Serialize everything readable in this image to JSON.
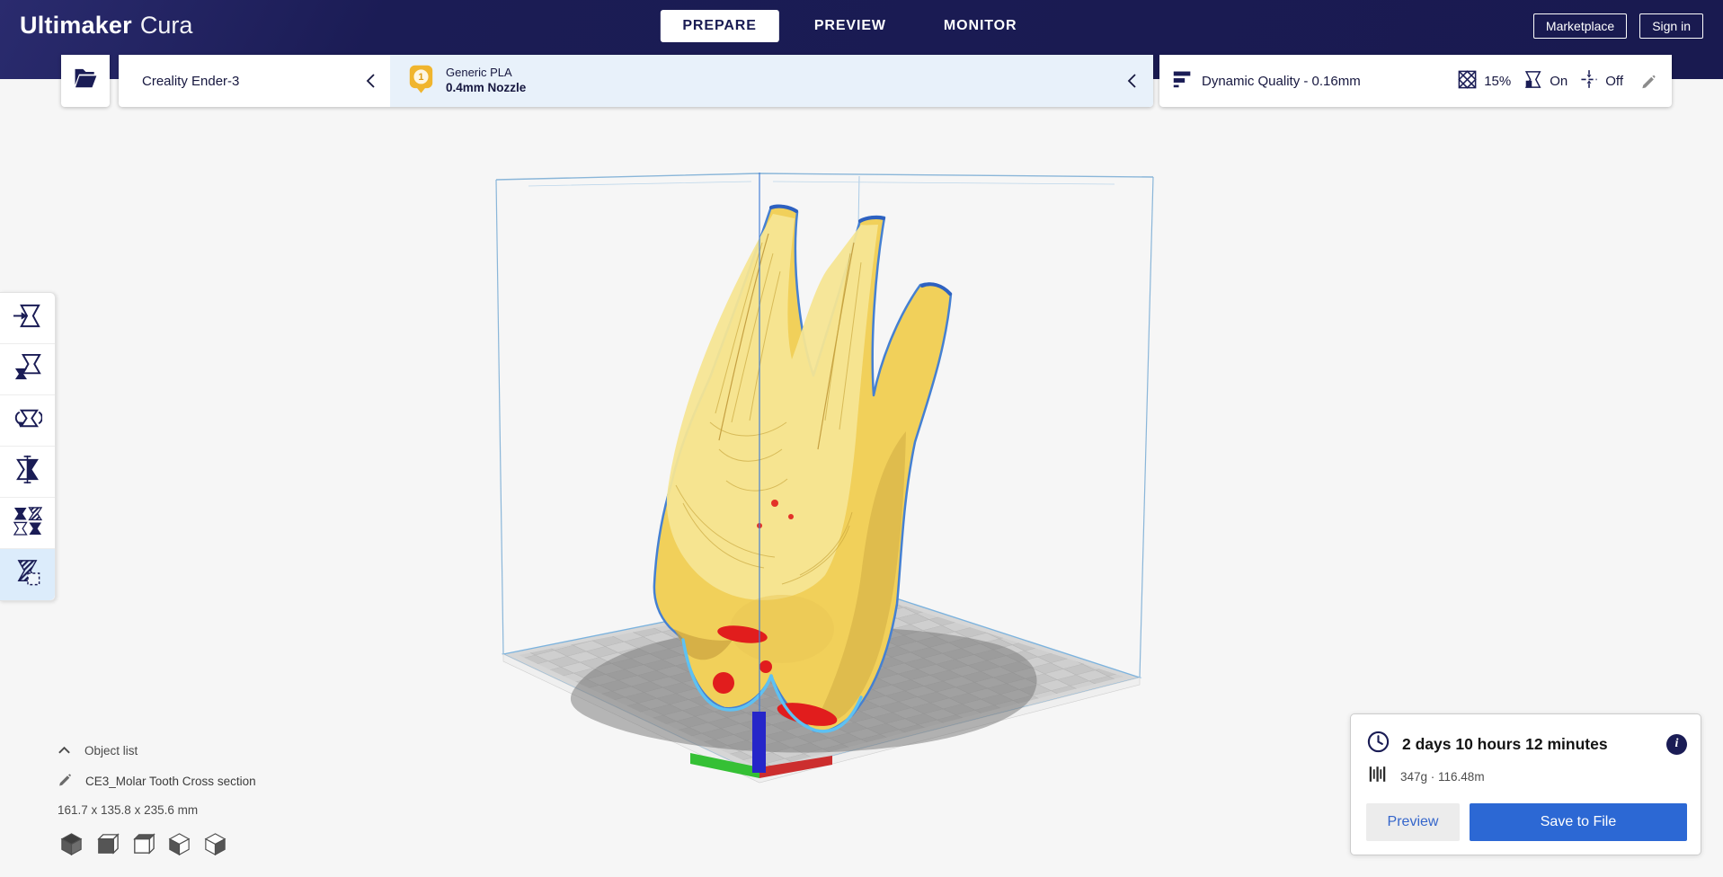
{
  "brand": {
    "name_bold": "Ultimaker",
    "name_light": "Cura"
  },
  "header": {
    "tabs": [
      {
        "label": "PREPARE",
        "active": true
      },
      {
        "label": "PREVIEW",
        "active": false
      },
      {
        "label": "MONITOR",
        "active": false
      }
    ],
    "marketplace_label": "Marketplace",
    "sign_in_label": "Sign in"
  },
  "config_bar": {
    "printer_name": "Creality Ender-3",
    "material_badge_count": "1",
    "material_name": "Generic PLA",
    "material_nozzle": "0.4mm Nozzle",
    "profile": "Dynamic Quality - 0.16mm",
    "infill": "15%",
    "support": "On",
    "adhesion": "Off"
  },
  "toolbar": {
    "tools": [
      {
        "id": "move",
        "selected": false
      },
      {
        "id": "scale",
        "selected": false
      },
      {
        "id": "rotate",
        "selected": false
      },
      {
        "id": "mirror",
        "selected": false
      },
      {
        "id": "per-model-settings",
        "selected": false
      },
      {
        "id": "support-blocker",
        "selected": true
      }
    ]
  },
  "object_panel": {
    "title": "Object list",
    "object_name": "CE3_Molar Tooth Cross section",
    "dimensions": "161.7 x 135.8 x 235.6 mm"
  },
  "view_presets": [
    "3d-view",
    "front-view",
    "top-view",
    "left-view",
    "right-view"
  ],
  "output_panel": {
    "print_time": "2 days 10 hours 12 minutes",
    "material_usage": "347g · 116.48m",
    "info_glyph": "i",
    "preview_label": "Preview",
    "save_label": "Save to File"
  },
  "colors": {
    "header_navy": "#1b1c55",
    "accent_blue": "#2c68d4",
    "material_section_bg": "#e8f1fa",
    "model_yellow": "#f1d05a",
    "model_section_yellow": "#f5e593",
    "overhang_red": "#e11d1d",
    "selection_outline": "#4580d2",
    "build_plate_gray": "#cdcdcd"
  }
}
